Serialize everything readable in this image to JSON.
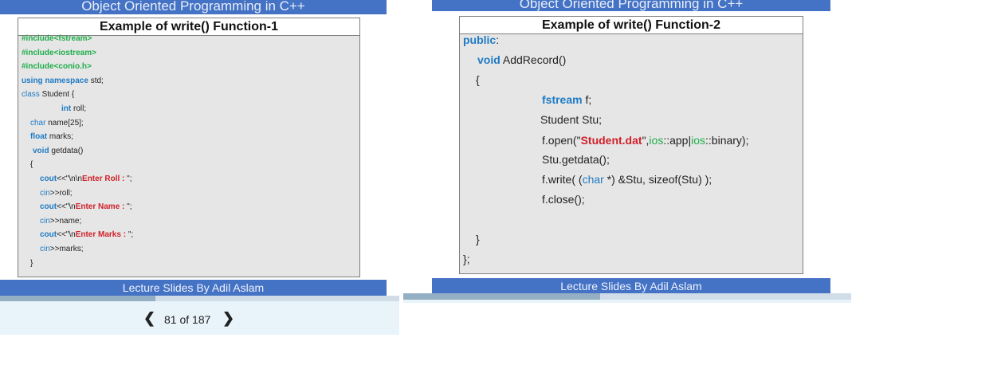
{
  "slides": [
    {
      "header": "Object Oriented Programming in C++",
      "title": "Example of write() Function-1",
      "footer": "Lecture Slides By Adil Aslam",
      "code": [
        [
          {
            "t": "#include<fstream>",
            "c": "gb"
          }
        ],
        [
          {
            "t": "#include<iostream>",
            "c": "gb"
          }
        ],
        [
          {
            "t": "#include<conio.h>",
            "c": "gb"
          }
        ],
        [
          {
            "t": "using namespace",
            "c": "k"
          },
          {
            "t": " std;",
            "c": ""
          }
        ],
        [
          {
            "t": "class",
            "c": "k2"
          },
          {
            "t": " Student {",
            "c": ""
          }
        ],
        [
          {
            "t": "int",
            "c": "k"
          },
          {
            "t": " roll;",
            "c": ""
          }
        ],
        [
          {
            "t": "char",
            "c": "k2"
          },
          {
            "t": " name[25];",
            "c": ""
          }
        ],
        [
          {
            "t": "float",
            "c": "k"
          },
          {
            "t": " marks;",
            "c": ""
          }
        ],
        [
          {
            "t": "void",
            "c": "k"
          },
          {
            "t": " getdata()",
            "c": ""
          }
        ],
        [
          {
            "t": "{",
            "c": ""
          }
        ],
        [
          {
            "t": "cout",
            "c": "k"
          },
          {
            "t": "<<\"\\n\\n",
            "c": ""
          },
          {
            "t": "Enter Roll : ",
            "c": "r"
          },
          {
            "t": "\";",
            "c": ""
          }
        ],
        [
          {
            "t": "cin",
            "c": "k2"
          },
          {
            "t": ">>roll;",
            "c": ""
          }
        ],
        [
          {
            "t": "cout",
            "c": "k"
          },
          {
            "t": "<<\"\\n",
            "c": ""
          },
          {
            "t": "Enter Name : ",
            "c": "r"
          },
          {
            "t": "\";",
            "c": ""
          }
        ],
        [
          {
            "t": "cin",
            "c": "k2"
          },
          {
            "t": ">>name;",
            "c": ""
          }
        ],
        [
          {
            "t": "cout",
            "c": "k"
          },
          {
            "t": "<<\"\\n",
            "c": ""
          },
          {
            "t": "Enter Marks : ",
            "c": "r"
          },
          {
            "t": "\";",
            "c": ""
          }
        ],
        [
          {
            "t": "cin",
            "c": "k2"
          },
          {
            "t": ">>marks;",
            "c": ""
          }
        ],
        [
          {
            "t": "}",
            "c": ""
          }
        ]
      ]
    },
    {
      "header": "Object Oriented Programming in C++",
      "title": "Example of write() Function-2",
      "footer": "Lecture Slides By Adil Aslam",
      "code": [
        [
          {
            "t": "public",
            "c": "k"
          },
          {
            "t": ":",
            "c": ""
          }
        ],
        [
          {
            "t": "void",
            "c": "k"
          },
          {
            "t": " AddRecord()",
            "c": ""
          }
        ],
        [
          {
            "t": "{",
            "c": ""
          }
        ],
        [
          {
            "t": "fstream",
            "c": "k"
          },
          {
            "t": " f;",
            "c": ""
          }
        ],
        [
          {
            "t": "Student Stu;",
            "c": ""
          }
        ],
        [
          {
            "t": "f.open(\"",
            "c": ""
          },
          {
            "t": "Student.dat",
            "c": "r"
          },
          {
            "t": "\",",
            "c": ""
          },
          {
            "t": "ios",
            "c": "g"
          },
          {
            "t": "::app|",
            "c": ""
          },
          {
            "t": "ios",
            "c": "g"
          },
          {
            "t": "::binary);",
            "c": ""
          }
        ],
        [
          {
            "t": "Stu.getdata();",
            "c": ""
          }
        ],
        [
          {
            "t": "f.write( (",
            "c": ""
          },
          {
            "t": "char",
            "c": "k2"
          },
          {
            "t": " *) &Stu, sizeof(Stu) );",
            "c": ""
          }
        ],
        [
          {
            "t": "f.close();",
            "c": ""
          }
        ],
        [
          {
            "t": "}",
            "c": ""
          }
        ],
        [
          {
            "t": "};",
            "c": ""
          }
        ]
      ]
    }
  ],
  "viewer": {
    "page_label": "81 of 187",
    "current_page": 81,
    "total_pages": 187,
    "prev_icon": "chevron-left-icon",
    "next_icon": "chevron-right-icon",
    "progress_fraction_left": 0.39,
    "progress_fraction_right": 0.44
  },
  "colors": {
    "header": "#4472c4",
    "keyword": "#1f7bc4",
    "string": "#d0202a",
    "preprocessor": "#1fae4a"
  }
}
